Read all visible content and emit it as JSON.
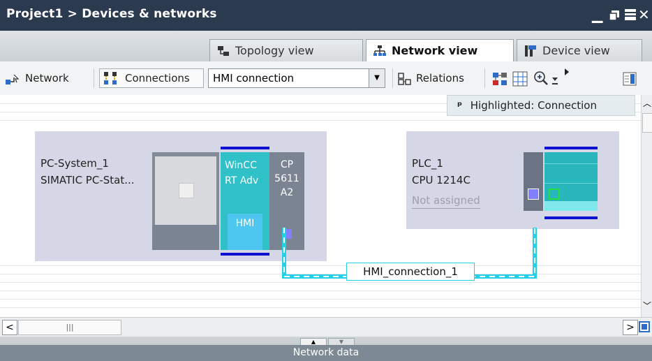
{
  "window": {
    "title": "Project1 > Devices & networks",
    "controls": [
      "minimize-icon",
      "restore-icon",
      "maximize-icon",
      "close-icon"
    ]
  },
  "tabs": [
    {
      "label": "Topology view",
      "icon": "topology-icon",
      "active": false
    },
    {
      "label": "Network view",
      "icon": "network-icon",
      "active": true
    },
    {
      "label": "Device view",
      "icon": "device-icon",
      "active": false
    }
  ],
  "toolbar": {
    "network_label": "Network",
    "connections_label": "Connections",
    "connection_type": "HMI connection",
    "relations_label": "Relations"
  },
  "canvas": {
    "highlight_label": "Highlighted: Connection",
    "pc_system": {
      "name": "PC-System_1",
      "type": "SIMATIC PC-Stat...",
      "wincc_label_1": "WinCC",
      "wincc_label_2": "RT Adv",
      "hmi_label": "HMI",
      "cp_label_1": "CP",
      "cp_label_2": "5611",
      "cp_label_3": "A2"
    },
    "plc": {
      "name": "PLC_1",
      "type": "CPU 1214C",
      "assignment": "Not assigned"
    },
    "connection_label": "HMI_connection_1"
  },
  "hscroll": {
    "thumb_grip": "|||"
  },
  "bottom": {
    "network_data_label": "Network data"
  },
  "colors": {
    "titlebar": "#2b3a4f",
    "device_box": "#d5d6e6",
    "wincc_teal": "#2fc0c8",
    "connection_cyan": "#22d0e8",
    "port_purple": "#8080ff",
    "module_blue": "#1010d0"
  }
}
